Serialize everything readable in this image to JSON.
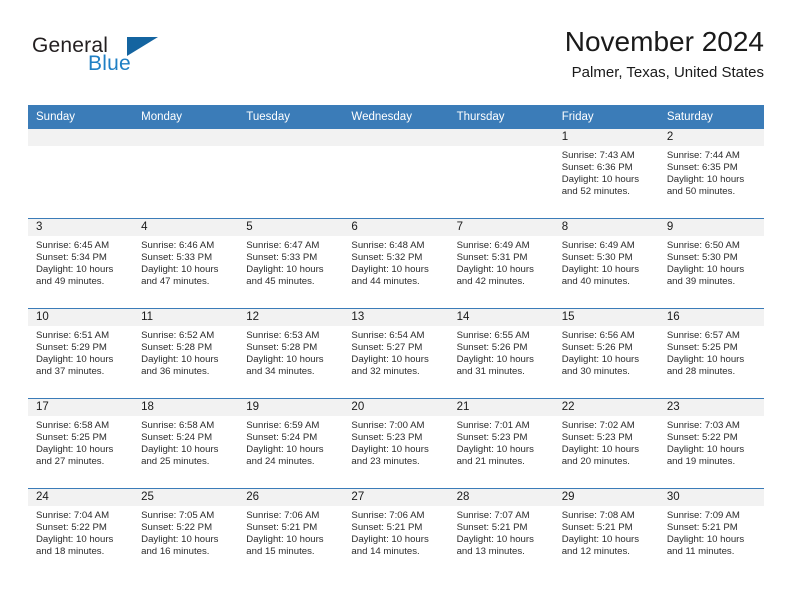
{
  "brand": {
    "name_part1": "General",
    "name_part2": "Blue",
    "flag_icon": "triangle-flag-icon"
  },
  "header": {
    "title": "November 2024",
    "subtitle": "Palmer, Texas, United States"
  },
  "calendar": {
    "weekday_headers": [
      "Sunday",
      "Monday",
      "Tuesday",
      "Wednesday",
      "Thursday",
      "Friday",
      "Saturday"
    ],
    "colors": {
      "header_blue": "#3b7cb8",
      "daynum_strip": "#f2f2f2",
      "brand_blue": "#1f7fc4",
      "flag_blue": "#1464a0"
    },
    "weeks": [
      [
        {
          "day": "",
          "sunrise": "",
          "sunset": "",
          "daylight": ""
        },
        {
          "day": "",
          "sunrise": "",
          "sunset": "",
          "daylight": ""
        },
        {
          "day": "",
          "sunrise": "",
          "sunset": "",
          "daylight": ""
        },
        {
          "day": "",
          "sunrise": "",
          "sunset": "",
          "daylight": ""
        },
        {
          "day": "",
          "sunrise": "",
          "sunset": "",
          "daylight": ""
        },
        {
          "day": "1",
          "sunrise": "Sunrise: 7:43 AM",
          "sunset": "Sunset: 6:36 PM",
          "daylight": "Daylight: 10 hours and 52 minutes."
        },
        {
          "day": "2",
          "sunrise": "Sunrise: 7:44 AM",
          "sunset": "Sunset: 6:35 PM",
          "daylight": "Daylight: 10 hours and 50 minutes."
        }
      ],
      [
        {
          "day": "3",
          "sunrise": "Sunrise: 6:45 AM",
          "sunset": "Sunset: 5:34 PM",
          "daylight": "Daylight: 10 hours and 49 minutes."
        },
        {
          "day": "4",
          "sunrise": "Sunrise: 6:46 AM",
          "sunset": "Sunset: 5:33 PM",
          "daylight": "Daylight: 10 hours and 47 minutes."
        },
        {
          "day": "5",
          "sunrise": "Sunrise: 6:47 AM",
          "sunset": "Sunset: 5:33 PM",
          "daylight": "Daylight: 10 hours and 45 minutes."
        },
        {
          "day": "6",
          "sunrise": "Sunrise: 6:48 AM",
          "sunset": "Sunset: 5:32 PM",
          "daylight": "Daylight: 10 hours and 44 minutes."
        },
        {
          "day": "7",
          "sunrise": "Sunrise: 6:49 AM",
          "sunset": "Sunset: 5:31 PM",
          "daylight": "Daylight: 10 hours and 42 minutes."
        },
        {
          "day": "8",
          "sunrise": "Sunrise: 6:49 AM",
          "sunset": "Sunset: 5:30 PM",
          "daylight": "Daylight: 10 hours and 40 minutes."
        },
        {
          "day": "9",
          "sunrise": "Sunrise: 6:50 AM",
          "sunset": "Sunset: 5:30 PM",
          "daylight": "Daylight: 10 hours and 39 minutes."
        }
      ],
      [
        {
          "day": "10",
          "sunrise": "Sunrise: 6:51 AM",
          "sunset": "Sunset: 5:29 PM",
          "daylight": "Daylight: 10 hours and 37 minutes."
        },
        {
          "day": "11",
          "sunrise": "Sunrise: 6:52 AM",
          "sunset": "Sunset: 5:28 PM",
          "daylight": "Daylight: 10 hours and 36 minutes."
        },
        {
          "day": "12",
          "sunrise": "Sunrise: 6:53 AM",
          "sunset": "Sunset: 5:28 PM",
          "daylight": "Daylight: 10 hours and 34 minutes."
        },
        {
          "day": "13",
          "sunrise": "Sunrise: 6:54 AM",
          "sunset": "Sunset: 5:27 PM",
          "daylight": "Daylight: 10 hours and 32 minutes."
        },
        {
          "day": "14",
          "sunrise": "Sunrise: 6:55 AM",
          "sunset": "Sunset: 5:26 PM",
          "daylight": "Daylight: 10 hours and 31 minutes."
        },
        {
          "day": "15",
          "sunrise": "Sunrise: 6:56 AM",
          "sunset": "Sunset: 5:26 PM",
          "daylight": "Daylight: 10 hours and 30 minutes."
        },
        {
          "day": "16",
          "sunrise": "Sunrise: 6:57 AM",
          "sunset": "Sunset: 5:25 PM",
          "daylight": "Daylight: 10 hours and 28 minutes."
        }
      ],
      [
        {
          "day": "17",
          "sunrise": "Sunrise: 6:58 AM",
          "sunset": "Sunset: 5:25 PM",
          "daylight": "Daylight: 10 hours and 27 minutes."
        },
        {
          "day": "18",
          "sunrise": "Sunrise: 6:58 AM",
          "sunset": "Sunset: 5:24 PM",
          "daylight": "Daylight: 10 hours and 25 minutes."
        },
        {
          "day": "19",
          "sunrise": "Sunrise: 6:59 AM",
          "sunset": "Sunset: 5:24 PM",
          "daylight": "Daylight: 10 hours and 24 minutes."
        },
        {
          "day": "20",
          "sunrise": "Sunrise: 7:00 AM",
          "sunset": "Sunset: 5:23 PM",
          "daylight": "Daylight: 10 hours and 23 minutes."
        },
        {
          "day": "21",
          "sunrise": "Sunrise: 7:01 AM",
          "sunset": "Sunset: 5:23 PM",
          "daylight": "Daylight: 10 hours and 21 minutes."
        },
        {
          "day": "22",
          "sunrise": "Sunrise: 7:02 AM",
          "sunset": "Sunset: 5:23 PM",
          "daylight": "Daylight: 10 hours and 20 minutes."
        },
        {
          "day": "23",
          "sunrise": "Sunrise: 7:03 AM",
          "sunset": "Sunset: 5:22 PM",
          "daylight": "Daylight: 10 hours and 19 minutes."
        }
      ],
      [
        {
          "day": "24",
          "sunrise": "Sunrise: 7:04 AM",
          "sunset": "Sunset: 5:22 PM",
          "daylight": "Daylight: 10 hours and 18 minutes."
        },
        {
          "day": "25",
          "sunrise": "Sunrise: 7:05 AM",
          "sunset": "Sunset: 5:22 PM",
          "daylight": "Daylight: 10 hours and 16 minutes."
        },
        {
          "day": "26",
          "sunrise": "Sunrise: 7:06 AM",
          "sunset": "Sunset: 5:21 PM",
          "daylight": "Daylight: 10 hours and 15 minutes."
        },
        {
          "day": "27",
          "sunrise": "Sunrise: 7:06 AM",
          "sunset": "Sunset: 5:21 PM",
          "daylight": "Daylight: 10 hours and 14 minutes."
        },
        {
          "day": "28",
          "sunrise": "Sunrise: 7:07 AM",
          "sunset": "Sunset: 5:21 PM",
          "daylight": "Daylight: 10 hours and 13 minutes."
        },
        {
          "day": "29",
          "sunrise": "Sunrise: 7:08 AM",
          "sunset": "Sunset: 5:21 PM",
          "daylight": "Daylight: 10 hours and 12 minutes."
        },
        {
          "day": "30",
          "sunrise": "Sunrise: 7:09 AM",
          "sunset": "Sunset: 5:21 PM",
          "daylight": "Daylight: 10 hours and 11 minutes."
        }
      ]
    ]
  }
}
